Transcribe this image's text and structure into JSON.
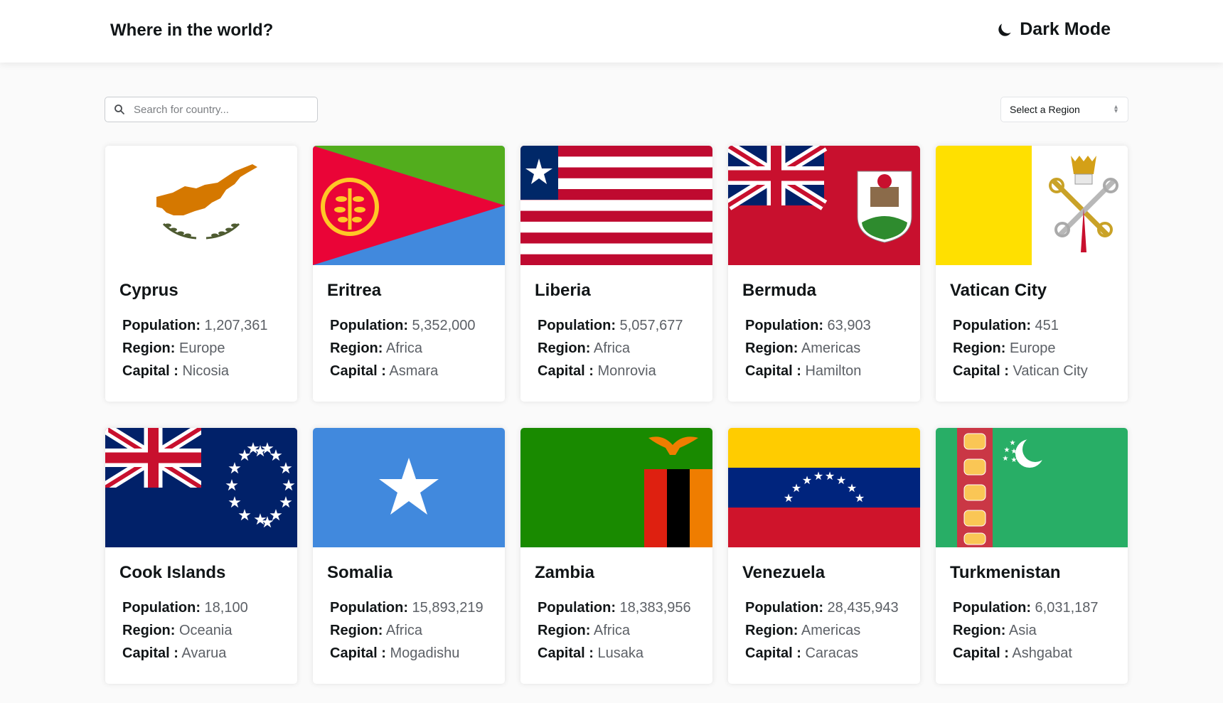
{
  "header": {
    "title": "Where in the world?",
    "mode_icon": "moon-icon",
    "mode_label": "Dark Mode"
  },
  "search": {
    "icon": "search-icon",
    "placeholder": "Search for country..."
  },
  "region_select": {
    "label": "Select a Region",
    "icon": "select-arrows-icon"
  },
  "labels": {
    "population": "Population:",
    "region": "Region:",
    "capital": "Capital :"
  },
  "countries": [
    {
      "name": "Cyprus",
      "population": "1,207,361",
      "region": "Europe",
      "capital": "Nicosia",
      "flag": "cyprus-flag"
    },
    {
      "name": "Eritrea",
      "population": "5,352,000",
      "region": "Africa",
      "capital": "Asmara",
      "flag": "eritrea-flag"
    },
    {
      "name": "Liberia",
      "population": "5,057,677",
      "region": "Africa",
      "capital": "Monrovia",
      "flag": "liberia-flag"
    },
    {
      "name": "Bermuda",
      "population": "63,903",
      "region": "Americas",
      "capital": "Hamilton",
      "flag": "bermuda-flag"
    },
    {
      "name": "Vatican City",
      "population": "451",
      "region": "Europe",
      "capital": "Vatican City",
      "flag": "vatican-flag"
    },
    {
      "name": "Cook Islands",
      "population": "18,100",
      "region": "Oceania",
      "capital": "Avarua",
      "flag": "cook-islands-flag"
    },
    {
      "name": "Somalia",
      "population": "15,893,219",
      "region": "Africa",
      "capital": "Mogadishu",
      "flag": "somalia-flag"
    },
    {
      "name": "Zambia",
      "population": "18,383,956",
      "region": "Africa",
      "capital": "Lusaka",
      "flag": "zambia-flag"
    },
    {
      "name": "Venezuela",
      "population": "28,435,943",
      "region": "Americas",
      "capital": "Caracas",
      "flag": "venezuela-flag"
    },
    {
      "name": "Turkmenistan",
      "population": "6,031,187",
      "region": "Asia",
      "capital": "Ashgabat",
      "flag": "turkmenistan-flag"
    }
  ],
  "colors": {
    "background": "#fafafa",
    "card": "#ffffff",
    "text": "#111517",
    "muted": "#5c6066"
  }
}
